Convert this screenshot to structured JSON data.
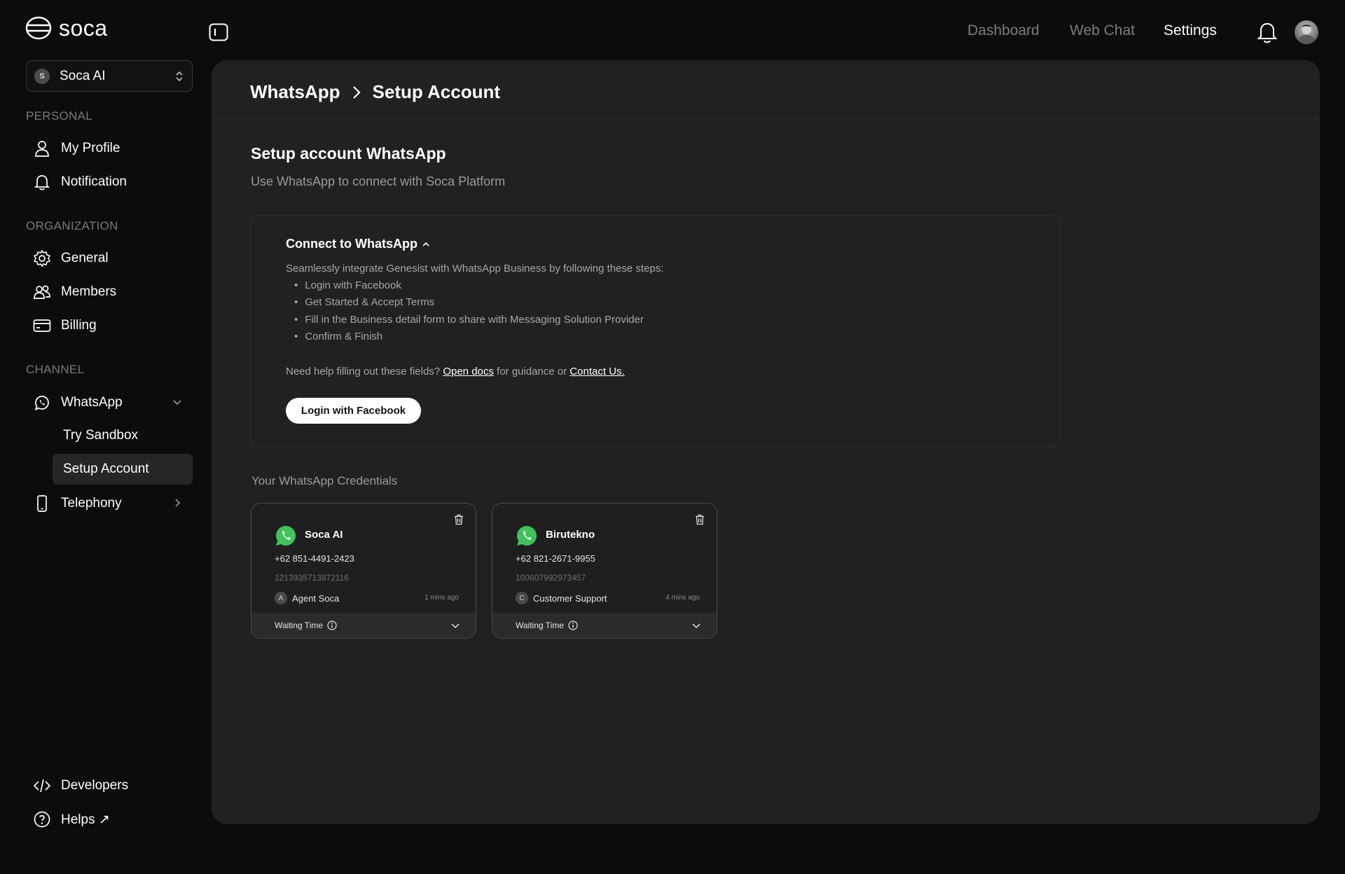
{
  "app": {
    "name": "soca"
  },
  "org_selector": {
    "initial": "S",
    "name": "Soca AI"
  },
  "sidebar": {
    "personal": {
      "label": "PERSONAL",
      "items": [
        {
          "label": "My Profile",
          "icon": "user-icon"
        },
        {
          "label": "Notification",
          "icon": "bell-icon"
        }
      ]
    },
    "organization": {
      "label": "ORGANIZATION",
      "items": [
        {
          "label": "General",
          "icon": "gear-icon"
        },
        {
          "label": "Members",
          "icon": "users-icon"
        },
        {
          "label": "Billing",
          "icon": "credit-card-icon"
        }
      ]
    },
    "channel": {
      "label": "CHANNEL",
      "whatsapp": {
        "label": "WhatsApp",
        "sub": [
          "Try Sandbox",
          "Setup Account"
        ],
        "active": "Setup Account"
      },
      "telephony": {
        "label": "Telephony"
      }
    },
    "bottom": [
      {
        "label": "Developers",
        "icon": "code-icon"
      },
      {
        "label": "Helps ↗",
        "icon": "help-circle-icon"
      }
    ]
  },
  "topnav": {
    "items": [
      "Dashboard",
      "Web Chat",
      "Settings"
    ],
    "active": "Settings"
  },
  "breadcrumb": [
    "WhatsApp",
    "Setup Account"
  ],
  "page": {
    "title": "Setup account WhatsApp",
    "subtitle": "Use WhatsApp to connect with Soca Platform"
  },
  "connect": {
    "title": "Connect to WhatsApp",
    "description": "Seamlessly integrate Genesist with WhatsApp Business by following these steps:",
    "steps": [
      "Login with Facebook",
      "Get Started & Accept Terms",
      "Fill in the Business detail form to share with Messaging Solution Provider",
      "Confirm & Finish"
    ],
    "help_prefix": "Need help filling out these fields?",
    "docs_link": "Open docs",
    "help_middle": "for guidance or",
    "contact_link": "Contact Us.",
    "button": "Login with Facebook"
  },
  "credentials": {
    "label": "Your WhatsApp Credentials",
    "cards": [
      {
        "name": "Soca AI",
        "phone": "+62 851-4491-2423",
        "id": "1213935713872116",
        "agent_initial": "A",
        "agent": "Agent Soca",
        "ago": "1 mins ago",
        "footer": "Waiting Time"
      },
      {
        "name": "Birutekno",
        "phone": "+62 821-2671-9955",
        "id": "100607992973457",
        "agent_initial": "C",
        "agent": "Customer Support",
        "ago": "4 mins ago",
        "footer": "Waiting Time"
      }
    ]
  },
  "colors": {
    "background": "#0c0c0c",
    "panel": "#212121",
    "whatsapp_green": "#3fc25a",
    "accent_text": "#ffffff",
    "muted_text": "#7a7a7a"
  }
}
